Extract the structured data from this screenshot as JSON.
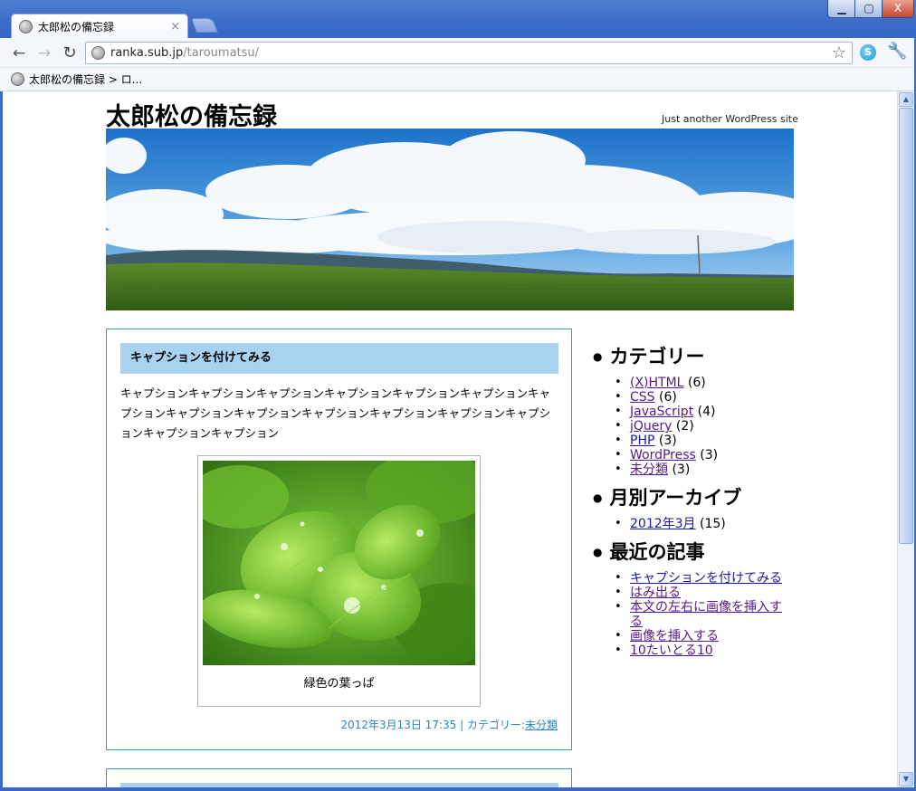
{
  "browser": {
    "tab_title": "太郎松の備忘録",
    "tab_close": "×",
    "url_host": "ranka.sub.jp",
    "url_path": "/taroumatsu/",
    "bookmark_label": "太郎松の備忘録 > ロ...",
    "back_glyph": "←",
    "forward_glyph": "→",
    "reload_glyph": "↻",
    "star_glyph": "☆",
    "wrench_glyph": "🔧",
    "window_min": "▁",
    "window_max": "▢",
    "window_close": "X"
  },
  "site": {
    "title": "太郎松の備忘録",
    "description": "Just another WordPress site"
  },
  "posts": [
    {
      "title": "キャプションを付けてみる",
      "body": "キャプションキャプションキャプションキャプションキャプションキャプションキャプションキャプションキャプションキャプションキャプションキャプションキャプションキャプションキャプション",
      "caption": "緑色の葉っぱ",
      "meta_date": "2012年3月13日 17:35 | カテゴリー:",
      "meta_category": "未分類"
    }
  ],
  "sidebar": {
    "categories": {
      "title": "カテゴリー",
      "items": [
        {
          "label": "(X)HTML",
          "count": "(6)"
        },
        {
          "label": "CSS",
          "count": "(6)"
        },
        {
          "label": "JavaScript",
          "count": "(4)"
        },
        {
          "label": "jQuery",
          "count": "(2)"
        },
        {
          "label": "PHP",
          "count": "(3)"
        },
        {
          "label": "WordPress",
          "count": "(3)"
        },
        {
          "label": "未分類",
          "count": "(3)"
        }
      ]
    },
    "archives": {
      "title": "月別アーカイブ",
      "items": [
        {
          "label": "2012年3月",
          "count": "(15)"
        }
      ]
    },
    "recent": {
      "title": "最近の記事",
      "items": [
        "キャプションを付けてみる",
        "はみ出る",
        "本文の左右に画像を挿入する",
        "画像を挿入する",
        "10たいとる10"
      ]
    }
  },
  "colors": {
    "post_border": "#3a93cc",
    "post_title_bg": "#a9d2f1",
    "meta_text": "#2a86c7",
    "link": "#1a1a9f"
  }
}
